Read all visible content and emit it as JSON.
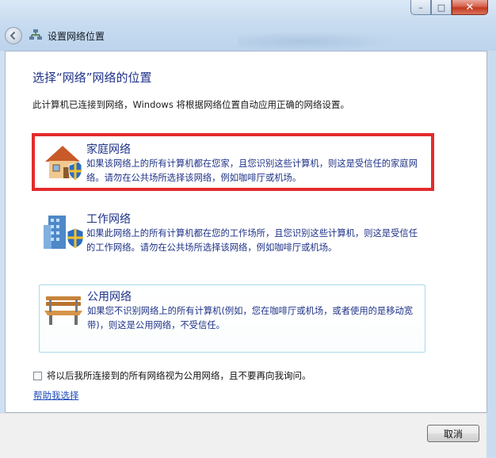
{
  "window": {
    "title": "设置网络位置",
    "controls": {
      "minimize": "–",
      "maximize": "□",
      "close": "✕"
    }
  },
  "heading": "选择“网络”网络的位置",
  "description": "此计算机已连接到网络，Windows 将根据网络位置自动应用正确的网络设置。",
  "options": [
    {
      "title": "家庭网络",
      "description": "如果该网络上的所有计算机都在您家，且您识别这些计算机，则这是受信任的家庭网络。请勿在公共场所选择该网络，例如咖啡厅或机场。",
      "icon": "house-shield-icon",
      "highlighted": true
    },
    {
      "title": "工作网络",
      "description": "如果此网络上的所有计算机都在您的工作场所，且您识别这些计算机，则这是受信任的工作网络。请勿在公共场所选择该网络，例如咖啡厅或机场。",
      "icon": "office-building-shield-icon",
      "highlighted": false
    },
    {
      "title": "公用网络",
      "description": "如果您不识别网络上的所有计算机(例如，您在咖啡厅或机场，或者使用的是移动宽带)，则这是公用网络，不受信任。",
      "icon": "park-bench-icon",
      "highlighted": false
    }
  ],
  "checkbox": {
    "label": "将以后我所连接到的所有网络视为公用网络，且不要再向我询问。",
    "checked": false
  },
  "help_link": "帮助我选择",
  "buttons": {
    "cancel": "取消"
  },
  "colors": {
    "heading": "#1e3287",
    "highlight": "#e32b2b",
    "link": "#1c4bb8",
    "titlebar": "#c7dcf0"
  }
}
